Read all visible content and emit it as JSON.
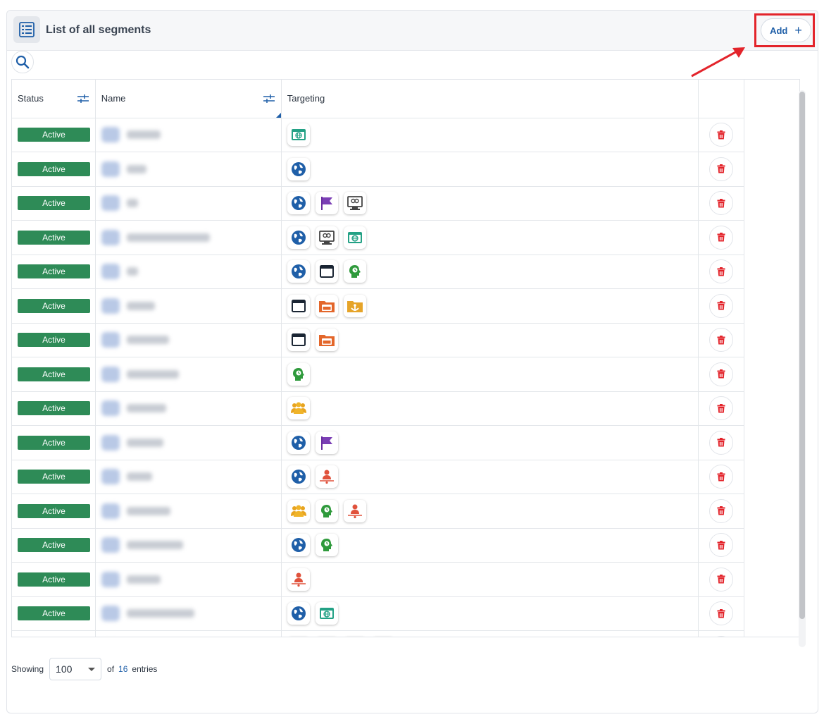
{
  "header": {
    "title": "List of all segments",
    "add_label": "Add",
    "add_icon": "plus-icon"
  },
  "table": {
    "columns": [
      "Status",
      "Name",
      "Targeting",
      ""
    ],
    "rows": [
      {
        "status": "Active",
        "targets": [
          "website"
        ]
      },
      {
        "status": "Active",
        "targets": [
          "globe"
        ]
      },
      {
        "status": "Active",
        "targets": [
          "globe",
          "flag",
          "monitor"
        ]
      },
      {
        "status": "Active",
        "targets": [
          "globe",
          "monitor",
          "website"
        ]
      },
      {
        "status": "Active",
        "targets": [
          "globe",
          "window",
          "head"
        ]
      },
      {
        "status": "Active",
        "targets": [
          "window",
          "folder-window",
          "folder-anchor"
        ]
      },
      {
        "status": "Active",
        "targets": [
          "window",
          "folder-window"
        ]
      },
      {
        "status": "Active",
        "targets": [
          "head"
        ]
      },
      {
        "status": "Active",
        "targets": [
          "group"
        ]
      },
      {
        "status": "Active",
        "targets": [
          "globe",
          "flag"
        ]
      },
      {
        "status": "Active",
        "targets": [
          "globe",
          "person-line"
        ]
      },
      {
        "status": "Active",
        "targets": [
          "group",
          "head",
          "person-line"
        ]
      },
      {
        "status": "Active",
        "targets": [
          "globe",
          "head"
        ]
      },
      {
        "status": "Active",
        "targets": [
          "person-line"
        ]
      },
      {
        "status": "Active",
        "targets": [
          "globe",
          "website"
        ]
      },
      {
        "status": "Active",
        "targets": [
          "globe",
          "flag",
          "monitor",
          "website"
        ]
      }
    ]
  },
  "name_widths": [
    48,
    28,
    16,
    118,
    16,
    40,
    60,
    74,
    56,
    52,
    36,
    62,
    80,
    48,
    96,
    70
  ],
  "footer": {
    "showing": "Showing",
    "page_size": "100",
    "of": "of",
    "count": "16",
    "entries": "entries"
  },
  "colors": {
    "active": "#2e8b57",
    "accent": "#1f5fa8",
    "delete": "#e3242b",
    "highlight": "#e3242b"
  }
}
